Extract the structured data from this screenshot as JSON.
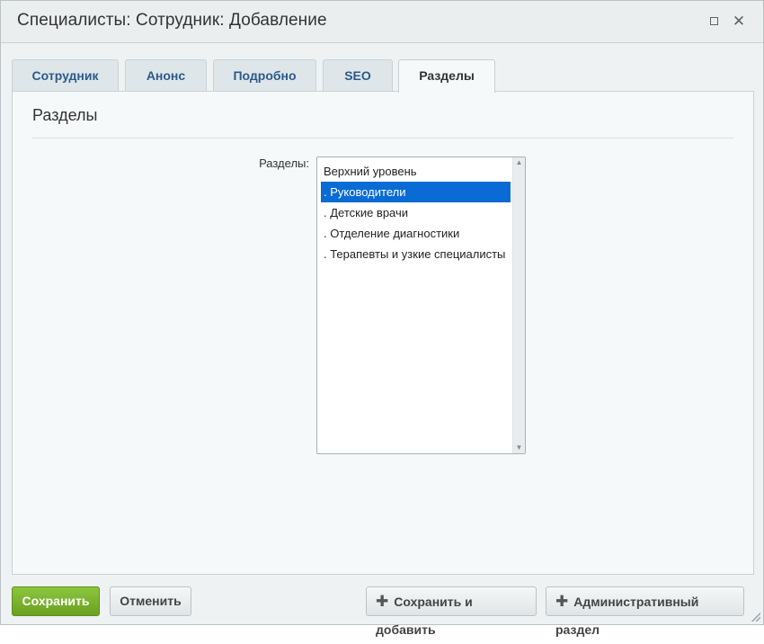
{
  "window": {
    "title": "Специалисты: Сотрудник: Добавление"
  },
  "tabs": [
    {
      "label": "Сотрудник"
    },
    {
      "label": "Анонс"
    },
    {
      "label": "Подробно"
    },
    {
      "label": "SEO"
    },
    {
      "label": "Разделы"
    }
  ],
  "panel": {
    "section_title": "Разделы",
    "field_label": "Разделы:",
    "list_items": [
      {
        "label": "Верхний уровень"
      },
      {
        "label": ". Руководители"
      },
      {
        "label": ". Детские врачи"
      },
      {
        "label": ". Отделение диагностики"
      },
      {
        "label": ". Терапевты и узкие специалисты"
      }
    ],
    "selected_item": ". Руководители"
  },
  "buttons": {
    "save": "Сохранить",
    "cancel": "Отменить",
    "save_and_add": "Сохранить и добавить",
    "admin_section": "Административный раздел"
  },
  "colors": {
    "accent_green": "#76b82a",
    "selection_blue": "#0a6bd4",
    "tab_text": "#2b5a8a"
  },
  "icons": {
    "maximize": "maximize-icon",
    "close": "close-icon",
    "plus": "plus-icon"
  }
}
